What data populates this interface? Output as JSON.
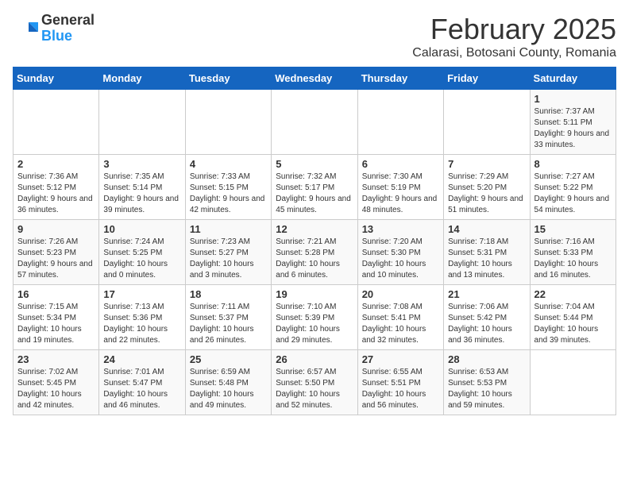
{
  "logo": {
    "general": "General",
    "blue": "Blue"
  },
  "title": "February 2025",
  "location": "Calarasi, Botosani County, Romania",
  "days_header": [
    "Sunday",
    "Monday",
    "Tuesday",
    "Wednesday",
    "Thursday",
    "Friday",
    "Saturday"
  ],
  "weeks": [
    [
      {
        "day": "",
        "info": ""
      },
      {
        "day": "",
        "info": ""
      },
      {
        "day": "",
        "info": ""
      },
      {
        "day": "",
        "info": ""
      },
      {
        "day": "",
        "info": ""
      },
      {
        "day": "",
        "info": ""
      },
      {
        "day": "1",
        "info": "Sunrise: 7:37 AM\nSunset: 5:11 PM\nDaylight: 9 hours and 33 minutes."
      }
    ],
    [
      {
        "day": "2",
        "info": "Sunrise: 7:36 AM\nSunset: 5:12 PM\nDaylight: 9 hours and 36 minutes."
      },
      {
        "day": "3",
        "info": "Sunrise: 7:35 AM\nSunset: 5:14 PM\nDaylight: 9 hours and 39 minutes."
      },
      {
        "day": "4",
        "info": "Sunrise: 7:33 AM\nSunset: 5:15 PM\nDaylight: 9 hours and 42 minutes."
      },
      {
        "day": "5",
        "info": "Sunrise: 7:32 AM\nSunset: 5:17 PM\nDaylight: 9 hours and 45 minutes."
      },
      {
        "day": "6",
        "info": "Sunrise: 7:30 AM\nSunset: 5:19 PM\nDaylight: 9 hours and 48 minutes."
      },
      {
        "day": "7",
        "info": "Sunrise: 7:29 AM\nSunset: 5:20 PM\nDaylight: 9 hours and 51 minutes."
      },
      {
        "day": "8",
        "info": "Sunrise: 7:27 AM\nSunset: 5:22 PM\nDaylight: 9 hours and 54 minutes."
      }
    ],
    [
      {
        "day": "9",
        "info": "Sunrise: 7:26 AM\nSunset: 5:23 PM\nDaylight: 9 hours and 57 minutes."
      },
      {
        "day": "10",
        "info": "Sunrise: 7:24 AM\nSunset: 5:25 PM\nDaylight: 10 hours and 0 minutes."
      },
      {
        "day": "11",
        "info": "Sunrise: 7:23 AM\nSunset: 5:27 PM\nDaylight: 10 hours and 3 minutes."
      },
      {
        "day": "12",
        "info": "Sunrise: 7:21 AM\nSunset: 5:28 PM\nDaylight: 10 hours and 6 minutes."
      },
      {
        "day": "13",
        "info": "Sunrise: 7:20 AM\nSunset: 5:30 PM\nDaylight: 10 hours and 10 minutes."
      },
      {
        "day": "14",
        "info": "Sunrise: 7:18 AM\nSunset: 5:31 PM\nDaylight: 10 hours and 13 minutes."
      },
      {
        "day": "15",
        "info": "Sunrise: 7:16 AM\nSunset: 5:33 PM\nDaylight: 10 hours and 16 minutes."
      }
    ],
    [
      {
        "day": "16",
        "info": "Sunrise: 7:15 AM\nSunset: 5:34 PM\nDaylight: 10 hours and 19 minutes."
      },
      {
        "day": "17",
        "info": "Sunrise: 7:13 AM\nSunset: 5:36 PM\nDaylight: 10 hours and 22 minutes."
      },
      {
        "day": "18",
        "info": "Sunrise: 7:11 AM\nSunset: 5:37 PM\nDaylight: 10 hours and 26 minutes."
      },
      {
        "day": "19",
        "info": "Sunrise: 7:10 AM\nSunset: 5:39 PM\nDaylight: 10 hours and 29 minutes."
      },
      {
        "day": "20",
        "info": "Sunrise: 7:08 AM\nSunset: 5:41 PM\nDaylight: 10 hours and 32 minutes."
      },
      {
        "day": "21",
        "info": "Sunrise: 7:06 AM\nSunset: 5:42 PM\nDaylight: 10 hours and 36 minutes."
      },
      {
        "day": "22",
        "info": "Sunrise: 7:04 AM\nSunset: 5:44 PM\nDaylight: 10 hours and 39 minutes."
      }
    ],
    [
      {
        "day": "23",
        "info": "Sunrise: 7:02 AM\nSunset: 5:45 PM\nDaylight: 10 hours and 42 minutes."
      },
      {
        "day": "24",
        "info": "Sunrise: 7:01 AM\nSunset: 5:47 PM\nDaylight: 10 hours and 46 minutes."
      },
      {
        "day": "25",
        "info": "Sunrise: 6:59 AM\nSunset: 5:48 PM\nDaylight: 10 hours and 49 minutes."
      },
      {
        "day": "26",
        "info": "Sunrise: 6:57 AM\nSunset: 5:50 PM\nDaylight: 10 hours and 52 minutes."
      },
      {
        "day": "27",
        "info": "Sunrise: 6:55 AM\nSunset: 5:51 PM\nDaylight: 10 hours and 56 minutes."
      },
      {
        "day": "28",
        "info": "Sunrise: 6:53 AM\nSunset: 5:53 PM\nDaylight: 10 hours and 59 minutes."
      },
      {
        "day": "",
        "info": ""
      }
    ]
  ]
}
